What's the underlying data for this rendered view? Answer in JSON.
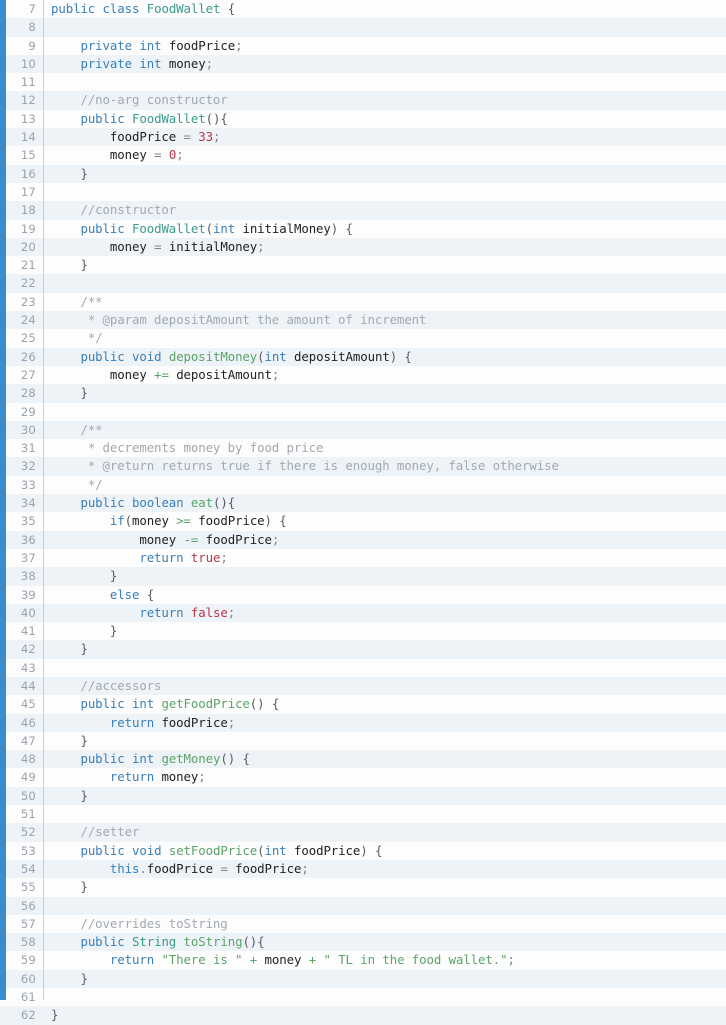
{
  "viewer": {
    "name": "code-viewer",
    "language": "java",
    "accent_color": "#3a8ccc",
    "background": "#fdfdfd",
    "alt_row_background": "#eef3f8",
    "first_line_number": 7,
    "last_line_number": 62
  },
  "palette": {
    "keyword": "#3a7fb8",
    "type": "#3a9b8c",
    "function": "#5aa469",
    "identifier": "#222222",
    "number": "#b5384a",
    "string": "#5aa469",
    "comment": "#a2a9b0",
    "operator": "#7d858d",
    "punctuation": "#555c63",
    "line_number": "#9aa3ad"
  },
  "lines": [
    {
      "n": "7",
      "tokens": [
        {
          "t": "public",
          "c": "kw"
        },
        {
          "t": " ",
          "c": "op"
        },
        {
          "t": "class",
          "c": "kw"
        },
        {
          "t": " ",
          "c": "op"
        },
        {
          "t": "FoodWallet",
          "c": "type"
        },
        {
          "t": " ",
          "c": "op"
        },
        {
          "t": "{",
          "c": "pun"
        }
      ]
    },
    {
      "n": "8",
      "tokens": []
    },
    {
      "n": "9",
      "tokens": [
        {
          "t": "    ",
          "c": "op"
        },
        {
          "t": "private",
          "c": "kw"
        },
        {
          "t": " ",
          "c": "op"
        },
        {
          "t": "int",
          "c": "kw"
        },
        {
          "t": " ",
          "c": "op"
        },
        {
          "t": "foodPrice",
          "c": "id"
        },
        {
          "t": ";",
          "c": "op"
        }
      ]
    },
    {
      "n": "10",
      "tokens": [
        {
          "t": "    ",
          "c": "op"
        },
        {
          "t": "private",
          "c": "kw"
        },
        {
          "t": " ",
          "c": "op"
        },
        {
          "t": "int",
          "c": "kw"
        },
        {
          "t": " ",
          "c": "op"
        },
        {
          "t": "money",
          "c": "id"
        },
        {
          "t": ";",
          "c": "op"
        }
      ]
    },
    {
      "n": "11",
      "tokens": []
    },
    {
      "n": "12",
      "tokens": [
        {
          "t": "    ",
          "c": "op"
        },
        {
          "t": "//no-arg constructor",
          "c": "cmt"
        }
      ]
    },
    {
      "n": "13",
      "tokens": [
        {
          "t": "    ",
          "c": "op"
        },
        {
          "t": "public",
          "c": "kw"
        },
        {
          "t": " ",
          "c": "op"
        },
        {
          "t": "FoodWallet",
          "c": "type"
        },
        {
          "t": "(){",
          "c": "pun"
        }
      ]
    },
    {
      "n": "14",
      "tokens": [
        {
          "t": "        ",
          "c": "op"
        },
        {
          "t": "foodPrice",
          "c": "id"
        },
        {
          "t": " ",
          "c": "op"
        },
        {
          "t": "=",
          "c": "op"
        },
        {
          "t": " ",
          "c": "op"
        },
        {
          "t": "33",
          "c": "num"
        },
        {
          "t": ";",
          "c": "op"
        }
      ]
    },
    {
      "n": "15",
      "tokens": [
        {
          "t": "        ",
          "c": "op"
        },
        {
          "t": "money",
          "c": "id"
        },
        {
          "t": " ",
          "c": "op"
        },
        {
          "t": "=",
          "c": "op"
        },
        {
          "t": " ",
          "c": "op"
        },
        {
          "t": "0",
          "c": "num"
        },
        {
          "t": ";",
          "c": "op"
        }
      ]
    },
    {
      "n": "16",
      "tokens": [
        {
          "t": "    ",
          "c": "op"
        },
        {
          "t": "}",
          "c": "pun"
        }
      ]
    },
    {
      "n": "17",
      "tokens": []
    },
    {
      "n": "18",
      "tokens": [
        {
          "t": "    ",
          "c": "op"
        },
        {
          "t": "//constructor",
          "c": "cmt"
        }
      ]
    },
    {
      "n": "19",
      "tokens": [
        {
          "t": "    ",
          "c": "op"
        },
        {
          "t": "public",
          "c": "kw"
        },
        {
          "t": " ",
          "c": "op"
        },
        {
          "t": "FoodWallet",
          "c": "type"
        },
        {
          "t": "(",
          "c": "pun"
        },
        {
          "t": "int",
          "c": "kw"
        },
        {
          "t": " ",
          "c": "op"
        },
        {
          "t": "initialMoney",
          "c": "id"
        },
        {
          "t": ") ",
          "c": "pun"
        },
        {
          "t": "{",
          "c": "pun"
        }
      ]
    },
    {
      "n": "20",
      "tokens": [
        {
          "t": "        ",
          "c": "op"
        },
        {
          "t": "money",
          "c": "id"
        },
        {
          "t": " ",
          "c": "op"
        },
        {
          "t": "=",
          "c": "op"
        },
        {
          "t": " ",
          "c": "op"
        },
        {
          "t": "initialMoney",
          "c": "id"
        },
        {
          "t": ";",
          "c": "op"
        }
      ]
    },
    {
      "n": "21",
      "tokens": [
        {
          "t": "    ",
          "c": "op"
        },
        {
          "t": "}",
          "c": "pun"
        }
      ]
    },
    {
      "n": "22",
      "tokens": []
    },
    {
      "n": "23",
      "tokens": [
        {
          "t": "    ",
          "c": "op"
        },
        {
          "t": "/**",
          "c": "cmt"
        }
      ]
    },
    {
      "n": "24",
      "tokens": [
        {
          "t": "     ",
          "c": "op"
        },
        {
          "t": "* @param depositAmount the amount of increment",
          "c": "cmt"
        }
      ]
    },
    {
      "n": "25",
      "tokens": [
        {
          "t": "     ",
          "c": "op"
        },
        {
          "t": "*/",
          "c": "cmt"
        }
      ]
    },
    {
      "n": "26",
      "tokens": [
        {
          "t": "    ",
          "c": "op"
        },
        {
          "t": "public",
          "c": "kw"
        },
        {
          "t": " ",
          "c": "op"
        },
        {
          "t": "void",
          "c": "kw"
        },
        {
          "t": " ",
          "c": "op"
        },
        {
          "t": "depositMoney",
          "c": "fn"
        },
        {
          "t": "(",
          "c": "pun"
        },
        {
          "t": "int",
          "c": "kw"
        },
        {
          "t": " ",
          "c": "op"
        },
        {
          "t": "depositAmount",
          "c": "id"
        },
        {
          "t": ") ",
          "c": "pun"
        },
        {
          "t": "{",
          "c": "pun"
        }
      ]
    },
    {
      "n": "27",
      "tokens": [
        {
          "t": "        ",
          "c": "op"
        },
        {
          "t": "money",
          "c": "id"
        },
        {
          "t": " ",
          "c": "op"
        },
        {
          "t": "+=",
          "c": "opg"
        },
        {
          "t": " ",
          "c": "op"
        },
        {
          "t": "depositAmount",
          "c": "id"
        },
        {
          "t": ";",
          "c": "op"
        }
      ]
    },
    {
      "n": "28",
      "tokens": [
        {
          "t": "    ",
          "c": "op"
        },
        {
          "t": "}",
          "c": "pun"
        }
      ]
    },
    {
      "n": "29",
      "tokens": []
    },
    {
      "n": "30",
      "tokens": [
        {
          "t": "    ",
          "c": "op"
        },
        {
          "t": "/**",
          "c": "cmt"
        }
      ]
    },
    {
      "n": "31",
      "tokens": [
        {
          "t": "     ",
          "c": "op"
        },
        {
          "t": "* decrements money by food price",
          "c": "cmt"
        }
      ]
    },
    {
      "n": "32",
      "tokens": [
        {
          "t": "     ",
          "c": "op"
        },
        {
          "t": "* @return returns true if there is enough money, false otherwise",
          "c": "cmt"
        }
      ]
    },
    {
      "n": "33",
      "tokens": [
        {
          "t": "     ",
          "c": "op"
        },
        {
          "t": "*/",
          "c": "cmt"
        }
      ]
    },
    {
      "n": "34",
      "tokens": [
        {
          "t": "    ",
          "c": "op"
        },
        {
          "t": "public",
          "c": "kw"
        },
        {
          "t": " ",
          "c": "op"
        },
        {
          "t": "boolean",
          "c": "kw"
        },
        {
          "t": " ",
          "c": "op"
        },
        {
          "t": "eat",
          "c": "fn"
        },
        {
          "t": "(){",
          "c": "pun"
        }
      ]
    },
    {
      "n": "35",
      "tokens": [
        {
          "t": "        ",
          "c": "op"
        },
        {
          "t": "if",
          "c": "kw"
        },
        {
          "t": "(",
          "c": "pun"
        },
        {
          "t": "money",
          "c": "id"
        },
        {
          "t": " ",
          "c": "op"
        },
        {
          "t": ">=",
          "c": "opg"
        },
        {
          "t": " ",
          "c": "op"
        },
        {
          "t": "foodPrice",
          "c": "id"
        },
        {
          "t": ") ",
          "c": "pun"
        },
        {
          "t": "{",
          "c": "pun"
        }
      ]
    },
    {
      "n": "36",
      "tokens": [
        {
          "t": "            ",
          "c": "op"
        },
        {
          "t": "money",
          "c": "id"
        },
        {
          "t": " ",
          "c": "op"
        },
        {
          "t": "-=",
          "c": "opg"
        },
        {
          "t": " ",
          "c": "op"
        },
        {
          "t": "foodPrice",
          "c": "id"
        },
        {
          "t": ";",
          "c": "op"
        }
      ]
    },
    {
      "n": "37",
      "tokens": [
        {
          "t": "            ",
          "c": "op"
        },
        {
          "t": "return",
          "c": "kw"
        },
        {
          "t": " ",
          "c": "op"
        },
        {
          "t": "true",
          "c": "num"
        },
        {
          "t": ";",
          "c": "op"
        }
      ]
    },
    {
      "n": "38",
      "tokens": [
        {
          "t": "        ",
          "c": "op"
        },
        {
          "t": "}",
          "c": "pun"
        }
      ]
    },
    {
      "n": "39",
      "tokens": [
        {
          "t": "        ",
          "c": "op"
        },
        {
          "t": "else",
          "c": "kw"
        },
        {
          "t": " ",
          "c": "op"
        },
        {
          "t": "{",
          "c": "pun"
        }
      ]
    },
    {
      "n": "40",
      "tokens": [
        {
          "t": "            ",
          "c": "op"
        },
        {
          "t": "return",
          "c": "kw"
        },
        {
          "t": " ",
          "c": "op"
        },
        {
          "t": "false",
          "c": "num"
        },
        {
          "t": ";",
          "c": "op"
        }
      ]
    },
    {
      "n": "41",
      "tokens": [
        {
          "t": "        ",
          "c": "op"
        },
        {
          "t": "}",
          "c": "pun"
        }
      ]
    },
    {
      "n": "42",
      "tokens": [
        {
          "t": "    ",
          "c": "op"
        },
        {
          "t": "}",
          "c": "pun"
        }
      ]
    },
    {
      "n": "43",
      "tokens": []
    },
    {
      "n": "44",
      "tokens": [
        {
          "t": "    ",
          "c": "op"
        },
        {
          "t": "//accessors",
          "c": "cmt"
        }
      ]
    },
    {
      "n": "45",
      "tokens": [
        {
          "t": "    ",
          "c": "op"
        },
        {
          "t": "public",
          "c": "kw"
        },
        {
          "t": " ",
          "c": "op"
        },
        {
          "t": "int",
          "c": "kw"
        },
        {
          "t": " ",
          "c": "op"
        },
        {
          "t": "getFoodPrice",
          "c": "fn"
        },
        {
          "t": "() ",
          "c": "pun"
        },
        {
          "t": "{",
          "c": "pun"
        }
      ]
    },
    {
      "n": "46",
      "tokens": [
        {
          "t": "        ",
          "c": "op"
        },
        {
          "t": "return",
          "c": "kw"
        },
        {
          "t": " ",
          "c": "op"
        },
        {
          "t": "foodPrice",
          "c": "id"
        },
        {
          "t": ";",
          "c": "op"
        }
      ]
    },
    {
      "n": "47",
      "tokens": [
        {
          "t": "    ",
          "c": "op"
        },
        {
          "t": "}",
          "c": "pun"
        }
      ]
    },
    {
      "n": "48",
      "tokens": [
        {
          "t": "    ",
          "c": "op"
        },
        {
          "t": "public",
          "c": "kw"
        },
        {
          "t": " ",
          "c": "op"
        },
        {
          "t": "int",
          "c": "kw"
        },
        {
          "t": " ",
          "c": "op"
        },
        {
          "t": "getMoney",
          "c": "fn"
        },
        {
          "t": "() ",
          "c": "pun"
        },
        {
          "t": "{",
          "c": "pun"
        }
      ]
    },
    {
      "n": "49",
      "tokens": [
        {
          "t": "        ",
          "c": "op"
        },
        {
          "t": "return",
          "c": "kw"
        },
        {
          "t": " ",
          "c": "op"
        },
        {
          "t": "money",
          "c": "id"
        },
        {
          "t": ";",
          "c": "op"
        }
      ]
    },
    {
      "n": "50",
      "tokens": [
        {
          "t": "    ",
          "c": "op"
        },
        {
          "t": "}",
          "c": "pun"
        }
      ]
    },
    {
      "n": "51",
      "tokens": []
    },
    {
      "n": "52",
      "tokens": [
        {
          "t": "    ",
          "c": "op"
        },
        {
          "t": "//setter",
          "c": "cmt"
        }
      ]
    },
    {
      "n": "53",
      "tokens": [
        {
          "t": "    ",
          "c": "op"
        },
        {
          "t": "public",
          "c": "kw"
        },
        {
          "t": " ",
          "c": "op"
        },
        {
          "t": "void",
          "c": "kw"
        },
        {
          "t": " ",
          "c": "op"
        },
        {
          "t": "setFoodPrice",
          "c": "fn"
        },
        {
          "t": "(",
          "c": "pun"
        },
        {
          "t": "int",
          "c": "kw"
        },
        {
          "t": " ",
          "c": "op"
        },
        {
          "t": "foodPrice",
          "c": "id"
        },
        {
          "t": ") ",
          "c": "pun"
        },
        {
          "t": "{",
          "c": "pun"
        }
      ]
    },
    {
      "n": "54",
      "tokens": [
        {
          "t": "        ",
          "c": "op"
        },
        {
          "t": "this",
          "c": "kw"
        },
        {
          "t": ".",
          "c": "op"
        },
        {
          "t": "foodPrice",
          "c": "id"
        },
        {
          "t": " ",
          "c": "op"
        },
        {
          "t": "=",
          "c": "op"
        },
        {
          "t": " ",
          "c": "op"
        },
        {
          "t": "foodPrice",
          "c": "id"
        },
        {
          "t": ";",
          "c": "op"
        }
      ]
    },
    {
      "n": "55",
      "tokens": [
        {
          "t": "    ",
          "c": "op"
        },
        {
          "t": "}",
          "c": "pun"
        }
      ]
    },
    {
      "n": "56",
      "tokens": []
    },
    {
      "n": "57",
      "tokens": [
        {
          "t": "    ",
          "c": "op"
        },
        {
          "t": "//overrides toString",
          "c": "cmt"
        }
      ]
    },
    {
      "n": "58",
      "tokens": [
        {
          "t": "    ",
          "c": "op"
        },
        {
          "t": "public",
          "c": "kw"
        },
        {
          "t": " ",
          "c": "op"
        },
        {
          "t": "String",
          "c": "type"
        },
        {
          "t": " ",
          "c": "op"
        },
        {
          "t": "toString",
          "c": "fn"
        },
        {
          "t": "(){",
          "c": "pun"
        }
      ]
    },
    {
      "n": "59",
      "tokens": [
        {
          "t": "        ",
          "c": "op"
        },
        {
          "t": "return",
          "c": "kw"
        },
        {
          "t": " ",
          "c": "op"
        },
        {
          "t": "\"There is \"",
          "c": "str"
        },
        {
          "t": " ",
          "c": "op"
        },
        {
          "t": "+",
          "c": "opg"
        },
        {
          "t": " ",
          "c": "op"
        },
        {
          "t": "money",
          "c": "id"
        },
        {
          "t": " ",
          "c": "op"
        },
        {
          "t": "+",
          "c": "opg"
        },
        {
          "t": " ",
          "c": "op"
        },
        {
          "t": "\" TL in the food wallet.\"",
          "c": "str"
        },
        {
          "t": ";",
          "c": "op"
        }
      ]
    },
    {
      "n": "60",
      "tokens": [
        {
          "t": "    ",
          "c": "op"
        },
        {
          "t": "}",
          "c": "pun"
        }
      ]
    },
    {
      "n": "61",
      "tokens": []
    },
    {
      "n": "62",
      "tokens": [
        {
          "t": "}",
          "c": "pun"
        }
      ]
    }
  ]
}
